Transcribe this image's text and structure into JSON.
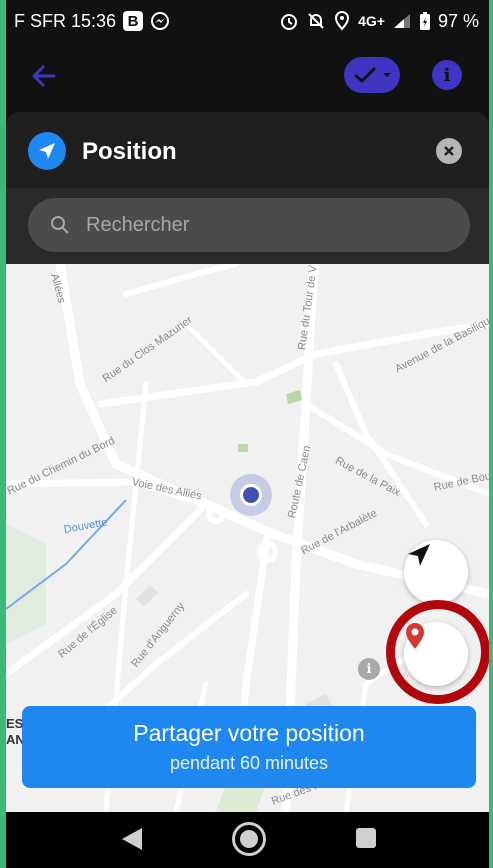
{
  "status_bar": {
    "carrier_time": "F SFR 15:36",
    "badge": "B",
    "network": "4G+",
    "battery": "97 %"
  },
  "sheet": {
    "title": "Position",
    "search_placeholder": "Rechercher"
  },
  "map": {
    "streets": [
      "Allées",
      "Rue du Clos Mazurier",
      "Rue du Tour de V",
      "Avenue de la Basilique",
      "Rue du Chemin du Bord",
      "Voie des Alliés",
      "Route de Caen",
      "Rue de la Paix",
      "Rue de Bourgo",
      "Rue de l'Arbalète",
      "Douvette",
      "Rue de l'Église",
      "Rue d'Anguerny",
      "Rue des Fossé"
    ],
    "edge_labels": [
      "ES-",
      "AN"
    ]
  },
  "share_button": {
    "line1": "Partager votre position",
    "line2": "pendant 60 minutes"
  },
  "colors": {
    "accent": "#1e88f0",
    "toolbar_purple": "#3f35c2",
    "highlight": "#b0060c",
    "pin": "#d23b33"
  }
}
